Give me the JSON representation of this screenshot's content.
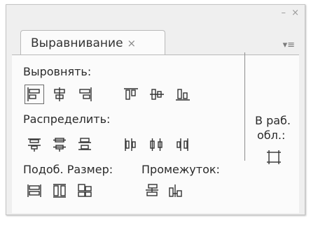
{
  "window": {
    "minimize_glyph": "–",
    "close_glyph": "×",
    "menu_glyph": "▾≡"
  },
  "tab": {
    "label": "Выравнивание",
    "close_glyph": "×"
  },
  "sections": {
    "align": "Выровнять:",
    "distribute": "Распределить:",
    "match_size": "Подоб. Размер:",
    "spacing": "Промежуток:",
    "to_stage_line1": "В раб.",
    "to_stage_line2": "обл.:"
  },
  "icons": {
    "align": [
      "align-left-edge-icon",
      "align-horizontal-center-icon",
      "align-right-edge-icon",
      "align-top-edge-icon",
      "align-vertical-center-icon",
      "align-bottom-edge-icon"
    ],
    "distribute": [
      "distribute-top-edge-icon",
      "distribute-vertical-center-icon",
      "distribute-bottom-edge-icon",
      "distribute-left-edge-icon",
      "distribute-horizontal-center-icon",
      "distribute-right-edge-icon"
    ],
    "match_size": [
      "match-width-icon",
      "match-height-icon",
      "match-width-and-height-icon"
    ],
    "spacing": [
      "space-evenly-vertically-icon",
      "space-evenly-horizontally-icon"
    ],
    "to_stage": [
      "to-stage-icon"
    ]
  },
  "colors": {
    "icon_stroke": "#333333",
    "panel_bg": "#efefef",
    "content_bg": "#fbfbfb",
    "divider": "#8e8e8e"
  }
}
